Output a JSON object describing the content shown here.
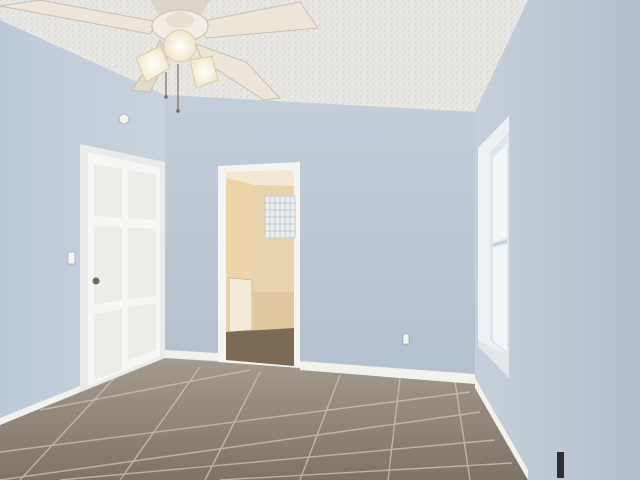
{
  "scene": {
    "description_tag": "empty-bedroom-interior",
    "colors": {
      "wall_left": "#c4d0dc",
      "wall_back": "#b9c6d3",
      "wall_right": "#bfcad6",
      "ceiling": "#e9e9e6",
      "floor": "#8f8478",
      "floor_grout": "#cfc6b9",
      "baseboard": "#f2f2f0",
      "door": "#f5f5f3",
      "bath_wall": "#efd9b4",
      "window_glass": "#e6eef4",
      "fan_blade": "#ece5d8"
    },
    "objects": [
      "ceiling-fan",
      "closet-door",
      "bathroom-doorway",
      "bathroom-vanity",
      "glass-block-window",
      "bedroom-window",
      "tile-floor",
      "wall-outlet",
      "light-switch",
      "wall-sensor"
    ]
  }
}
